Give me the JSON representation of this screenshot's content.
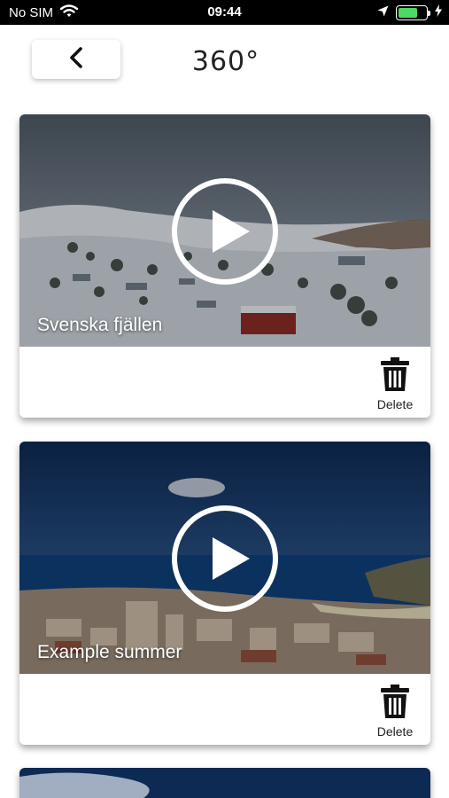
{
  "status_bar": {
    "carrier": "No SIM",
    "time": "09:44",
    "battery_level": 0.7,
    "battery_color": "#4cd964"
  },
  "header": {
    "back_icon": "chevron-left-icon",
    "title": "360°"
  },
  "videos": [
    {
      "title": "Svenska fjällen",
      "delete_label": "Delete",
      "scene": "snowy-mountain-village"
    },
    {
      "title": "Example summer",
      "delete_label": "Delete",
      "scene": "coastal-town-sea"
    }
  ],
  "icons": {
    "play": "play-circle-icon",
    "delete": "trash-icon",
    "wifi": "wifi-icon",
    "location": "location-arrow-icon",
    "charging": "bolt-icon"
  }
}
